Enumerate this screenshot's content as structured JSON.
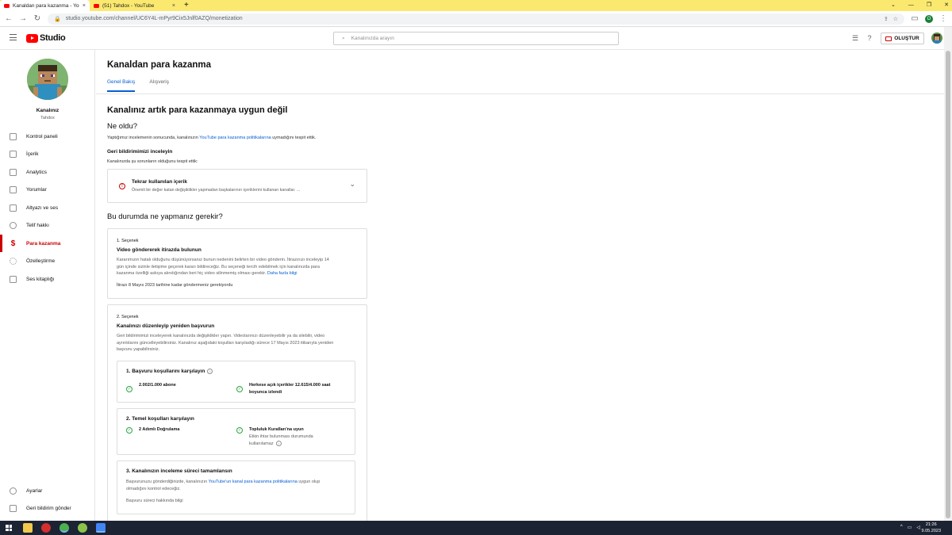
{
  "browser": {
    "tabs": [
      {
        "label": "Kanaldan para kazanma - YouTube Studio",
        "active": true
      },
      {
        "label": "(51) Tahdox - YouTube",
        "active": false
      }
    ],
    "url": "studio.youtube.com/channel/UC6Y4L-mPyr9Cix5Jnlf0AZQ/monetization",
    "profile_initial": "O"
  },
  "header": {
    "logo_text": "Studio",
    "search_placeholder": "Kanalınızda arayın",
    "create_label": "OLUŞTUR"
  },
  "sidebar": {
    "channel_name": "Kanalınız",
    "channel_handle": "Tahdox",
    "items": [
      {
        "label": "Kontrol paneli",
        "icon": "dashboard-icon"
      },
      {
        "label": "İçerik",
        "icon": "content-icon"
      },
      {
        "label": "Analytics",
        "icon": "analytics-icon"
      },
      {
        "label": "Yorumlar",
        "icon": "comments-icon"
      },
      {
        "label": "Altyazı ve ses",
        "icon": "subtitles-icon"
      },
      {
        "label": "Telif hakkı",
        "icon": "copyright-icon"
      },
      {
        "label": "Para kazanma",
        "icon": "dollar-icon",
        "active": true
      },
      {
        "label": "Özelleştirme",
        "icon": "customization-icon"
      },
      {
        "label": "Ses kitaplığı",
        "icon": "audio-library-icon"
      }
    ],
    "bottom_items": [
      {
        "label": "Ayarlar",
        "icon": "gear-icon"
      },
      {
        "label": "Geri bildirim gönder",
        "icon": "feedback-icon"
      }
    ]
  },
  "main": {
    "title": "Kanaldan para kazanma",
    "tabs": [
      "Genel Bakış",
      "Alışveriş"
    ],
    "status_heading": "Kanalınız artık para kazanmaya uygun değil",
    "what_happened": "Ne oldu?",
    "review_text_before": "Yaptığımız incelemenin sonucunda, kanalınızın ",
    "review_link": "YouTube para kazanma politikalarına",
    "review_text_after": " uymadığını tespit ettik.",
    "feedback_heading": "Geri bildirimimizi inceleyin",
    "feedback_sub": "Kanalınızda şu sorunların olduğunu tespit ettik:",
    "issue_title": "Tekrar kullanılan içerik",
    "issue_desc": "Önemli bir değer katan değişiklikler yapmadan başkalarının içeriklerini kullanan kanallar. ...",
    "next_heading": "Bu durumda ne yapmanız gerekir?",
    "option1": {
      "kicker": "1. Seçenek",
      "title": "Video göndererek itirazda bulunun",
      "line1": "Kararımızın hatalı olduğunu düşünüyorsanız bunun nedenini belirten bir video gönderin. İtirazınızı inceleyip 14",
      "line2": "gün içinde sizinle iletişime geçerek kararı bildireceğiz. Bu seçeneği tercih edebilmek için kanalınızda para",
      "line3": "kazanma özelliği askıya alındığından beri hiç video silinmemiş olması gerekir. ",
      "link": "Daha fazla bilgi",
      "deadline": "İtirazı 8 Mayıs 2023 tarihine kadar göndermeniz gerekiyordu"
    },
    "option2": {
      "kicker": "2. Seçenek",
      "title": "Kanalınızı düzenleyip yeniden başvurun",
      "line1": "Geri bildirimimizi inceleyerek kanalınızda değişiklikler yapın. Videolarınızı düzenleyebilir ya da silebilir, video",
      "line2": "ayrıntılarını güncelleyebilirsiniz. Kanalınız aşağıdaki koşulları karşıladığı sürece 17 Mayıs 2023 itibarıyla yeniden",
      "line3": "başvuru yapabilirsiniz.",
      "step1": {
        "title": "1. Başvuru koşullarını karşılayın",
        "req1": "2.002/1.000 abone",
        "req2_l1": "Herkese açık içerikler 12.615/4.000 saat",
        "req2_l2": "boyunca izlendi"
      },
      "step2": {
        "title": "2. Temel koşulları karşılayın",
        "req1": "2 Adımlı Doğrulama",
        "req2": "Topluluk Kuralları'na uyun",
        "req2_sub1": "Etkin ihtar bulunması durumunda",
        "req2_sub2": "kullanılamaz"
      },
      "step3": {
        "title": "3. Kanalınızın inceleme süreci tamamlansın",
        "text_before": "Başvurunuzu gönderdiğinizde, kanalınızın ",
        "link": "YouTube'un kanal para kazanma politikalarına",
        "text_after": " uygun olup",
        "line2": "olmadığını kontrol edeceğiz.",
        "help_link": "Başvuru süreci hakkında bilgi"
      }
    }
  },
  "taskbar": {
    "time": "21:26",
    "date": "9.05.2023"
  },
  "colors": {
    "accent_blue": "#065fd4",
    "brand_red": "#ff0000",
    "success_green": "#2ba640",
    "tab_bar_yellow": "#fbe96f"
  }
}
